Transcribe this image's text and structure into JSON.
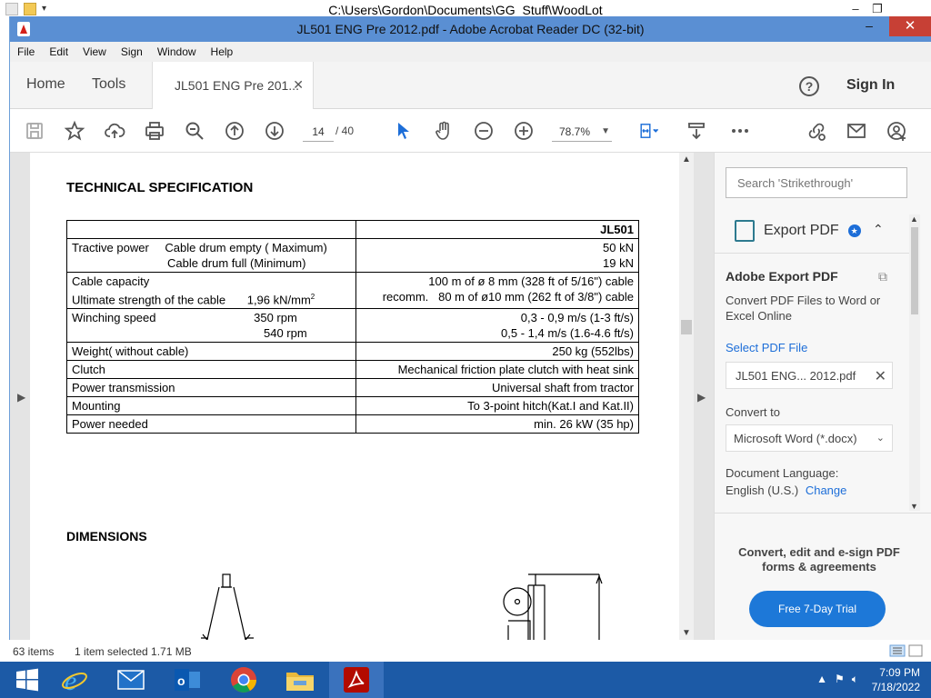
{
  "explorer": {
    "path": "C:\\Users\\Gordon\\Documents\\GG_Stuff\\WoodLot"
  },
  "window": {
    "title": "JL501 ENG Pre 2012.pdf - Adobe Acrobat Reader DC (32-bit)"
  },
  "menu": [
    "File",
    "Edit",
    "View",
    "Sign",
    "Window",
    "Help"
  ],
  "tabs": {
    "home": "Home",
    "tools": "Tools",
    "doc": "JL501 ENG Pre 201...",
    "sign_in": "Sign In"
  },
  "toolbar": {
    "page_current": "14",
    "page_total": "/ 40",
    "zoom": "78.7%"
  },
  "document": {
    "heading_spec": "TECHNICAL SPECIFICATION",
    "heading_dimensions": "DIMENSIONS",
    "table": {
      "model": "JL501",
      "rows": [
        {
          "l1": "Tractive power",
          "l2": "Cable drum empty ( Maximum)",
          "l3": "Cable drum full (Minimum)",
          "r1": "50 kN",
          "r2": "19 kN"
        },
        {
          "l1": "Cable capacity",
          "l2": "Ultimate strength of the cable",
          "l3": "1,96 kN/mm",
          "l3_sup": "2",
          "r1": "100 m of ø 8 mm (328 ft of 5/16\") cable",
          "r2": "recomm.   80 m of ø10 mm (262 ft of 3/8\") cable"
        },
        {
          "l1": "Winching speed",
          "l2": "350 rpm",
          "l3": "540 rpm",
          "r1": "0,3 - 0,9 m/s (1-3 ft/s)",
          "r2": "0,5 - 1,4 m/s (1.6-4.6 ft/s)"
        },
        {
          "l1": "Weight( without cable)",
          "r1": "250 kg (552lbs)"
        },
        {
          "l1": "Clutch",
          "r1": "Mechanical friction plate clutch with heat sink"
        },
        {
          "l1": "Power transmission",
          "r1": "Universal shaft from tractor"
        },
        {
          "l1": "Mounting",
          "r1": "To 3-point hitch(Kat.I and Kat.II)"
        },
        {
          "l1": "Power needed",
          "r1": "min. 26 kW (35 hp)"
        }
      ]
    }
  },
  "side_panel": {
    "search_placeholder": "Search 'Strikethrough'",
    "export_label": "Export PDF",
    "title": "Adobe Export PDF",
    "description": "Convert PDF Files to Word or Excel Online",
    "select_file_label": "Select PDF File",
    "file_name": "JL501 ENG... 2012.pdf",
    "convert_to_label": "Convert to",
    "convert_to_value": "Microsoft Word (*.docx)",
    "doc_language_label": "Document Language:",
    "doc_language_value": "English (U.S.)",
    "change_link": "Change",
    "promo": "Convert, edit and e-sign PDF forms & agreements",
    "trial_button": "Free 7-Day Trial"
  },
  "status": {
    "items": "63 items",
    "selected": "1 item selected  1.71 MB"
  },
  "taskbar": {
    "time": "7:09 PM",
    "date": "7/18/2022"
  },
  "colors": {
    "titlebar": "#5a8fd3",
    "close": "#c74035",
    "accent_blue": "#1d78d8",
    "taskbar": "#1c5aa6"
  }
}
